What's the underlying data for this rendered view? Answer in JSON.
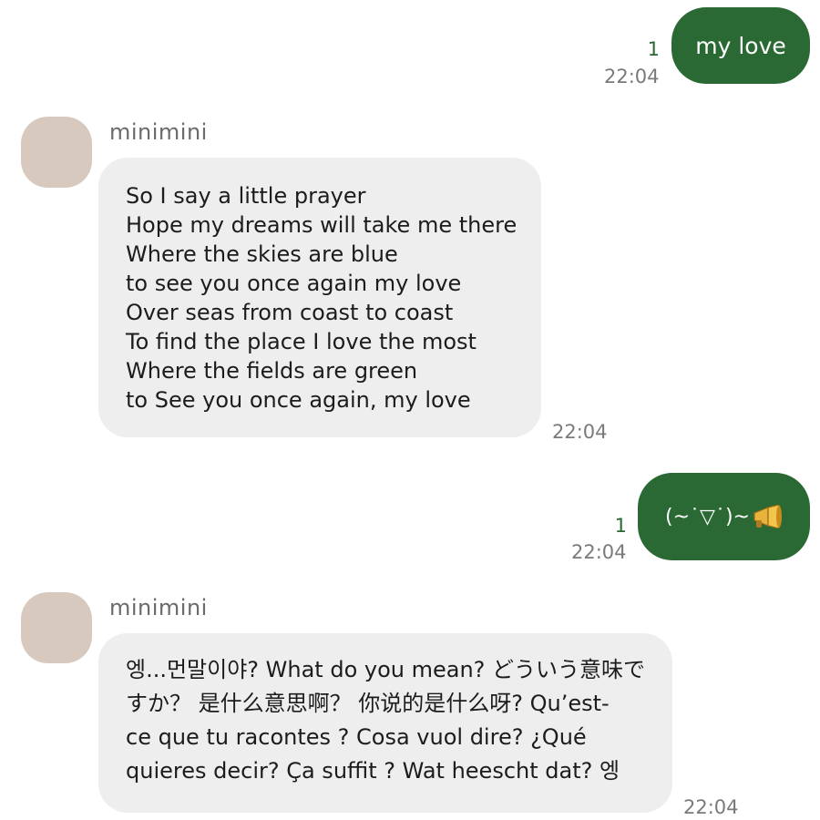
{
  "messages": {
    "out1": {
      "text": "my love",
      "read_count": "1",
      "time": "22:04"
    },
    "in1": {
      "sender": "minimini",
      "lines": [
        "So I say a little prayer",
        "Hope my dreams will take me there",
        "Where the skies are blue",
        "to see you once again my love",
        "Over seas from coast to coast",
        "To find the place I love the most",
        "Where the fields are green",
        "to See you once again, my love"
      ],
      "time": "22:04"
    },
    "out2": {
      "text": "(~˙▽˙)~",
      "icon": "megaphone-icon",
      "read_count": "1",
      "time": "22:04"
    },
    "in2": {
      "sender": "minimini",
      "lines": [
        "엥...먼말이야? What do you mean? どういう意味で",
        "すか？ 是什么意思啊？ 你说的是什么呀? Qu’est-",
        "ce que tu racontes ? Cosa vuol dire? ¿Qué",
        "quieres decir? Ça suffit ? Wat heescht dat? 엥"
      ],
      "time": "22:04"
    }
  },
  "colors": {
    "outgoing_bubble": "#2a6934",
    "incoming_bubble": "#eeeeee",
    "avatar": "#d8c9be",
    "read_count": "#2a6934",
    "timestamp": "#7a7a7a"
  }
}
